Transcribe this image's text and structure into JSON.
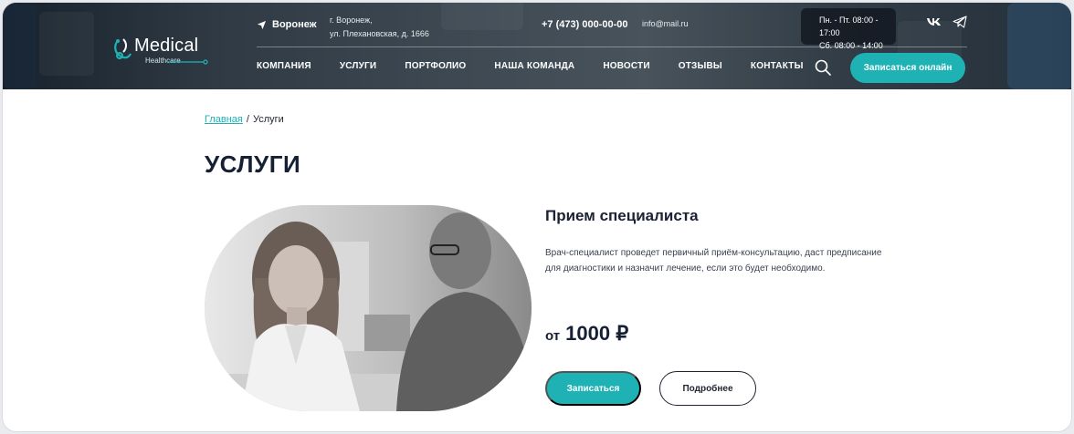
{
  "header": {
    "logo": {
      "word": "Medical",
      "sub": "Healthcare"
    },
    "city": "Воронеж",
    "address_line1": "г. Воронеж,",
    "address_line2": "ул. Плехановская, д. 1666",
    "phone": "+7 (473) 000-00-00",
    "email": "info@mail.ru",
    "hours_line1": "Пн. - Пт. 08:00 - 17:00",
    "hours_line2": "Сб. 08:00 - 14:00",
    "nav": [
      "КОМПАНИЯ",
      "УСЛУГИ",
      "ПОРТФОЛИО",
      "НАША КОМАНДА",
      "НОВОСТИ",
      "ОТЗЫВЫ",
      "КОНТАКТЫ"
    ],
    "cta_label": "Записаться онлайн"
  },
  "breadcrumb": {
    "home": "Главная",
    "separator": "/",
    "current": "Услуги"
  },
  "page_title": "УСЛУГИ",
  "service": {
    "title": "Прием специалиста",
    "description": "Врач-специалист проведет первичный приём-консультацию, даст предписание для диагностики и назначит лечение, если это будет необходимо.",
    "price_from": "от",
    "price_value": "1000 ₽",
    "book_label": "Записаться",
    "more_label": "Подробнее"
  },
  "icons": {
    "location": "location-arrow-icon",
    "vk": "vk-icon",
    "telegram": "telegram-icon",
    "search": "search-icon",
    "logo": "stethoscope-icon"
  },
  "colors": {
    "accent": "#1fb2b5",
    "heading": "#162033",
    "header_bg": "#3b4751"
  }
}
